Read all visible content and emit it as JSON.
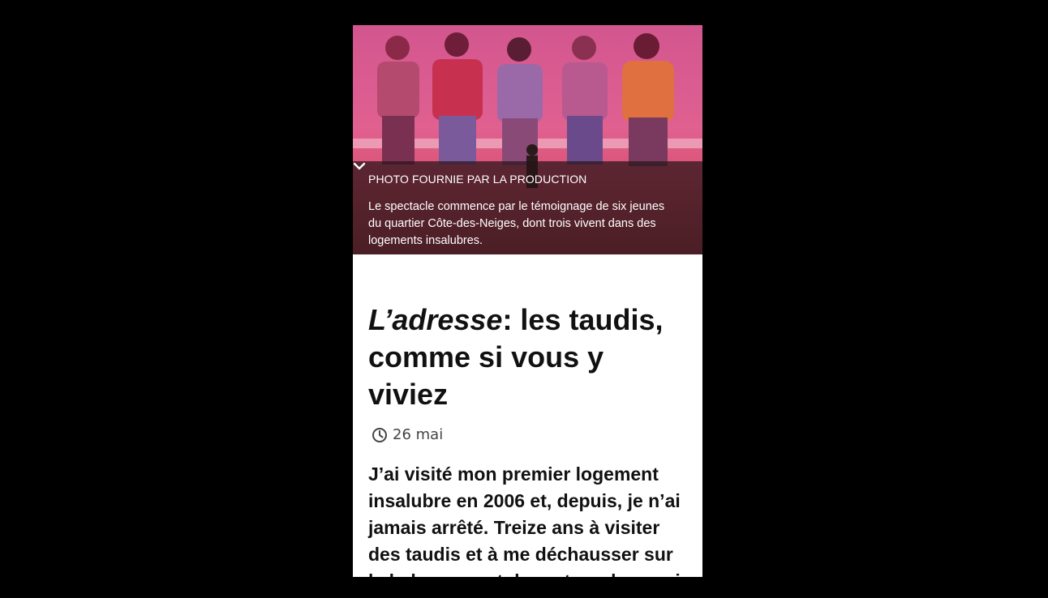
{
  "photo": {
    "credit": "PHOTO FOURNIE PAR LA PRODUCTION",
    "caption": "Le spectacle commence par le témoignage de six jeunes du quartier Côte-des-Neiges, dont trois vivent dans des logements insalubres.",
    "toggle_icon": "chevron-down-icon"
  },
  "article": {
    "title_italic": "L’adresse",
    "title_rest": ": les taudis, comme si vous y viviez",
    "date_icon": "clock-icon",
    "date": "26 mai",
    "lede": "J’ai visité mon premier logement insalubre en 2006 et, depuis, je n’ai jamais arrêté. Treize ans à visiter des taudis et à me déchausser sur le balcon avant de rentrer chez moi. Ce n’est pas pour me vanter, mais"
  },
  "colors": {
    "background": "#000000",
    "caption_overlay": "#281418",
    "text": "#111111"
  }
}
